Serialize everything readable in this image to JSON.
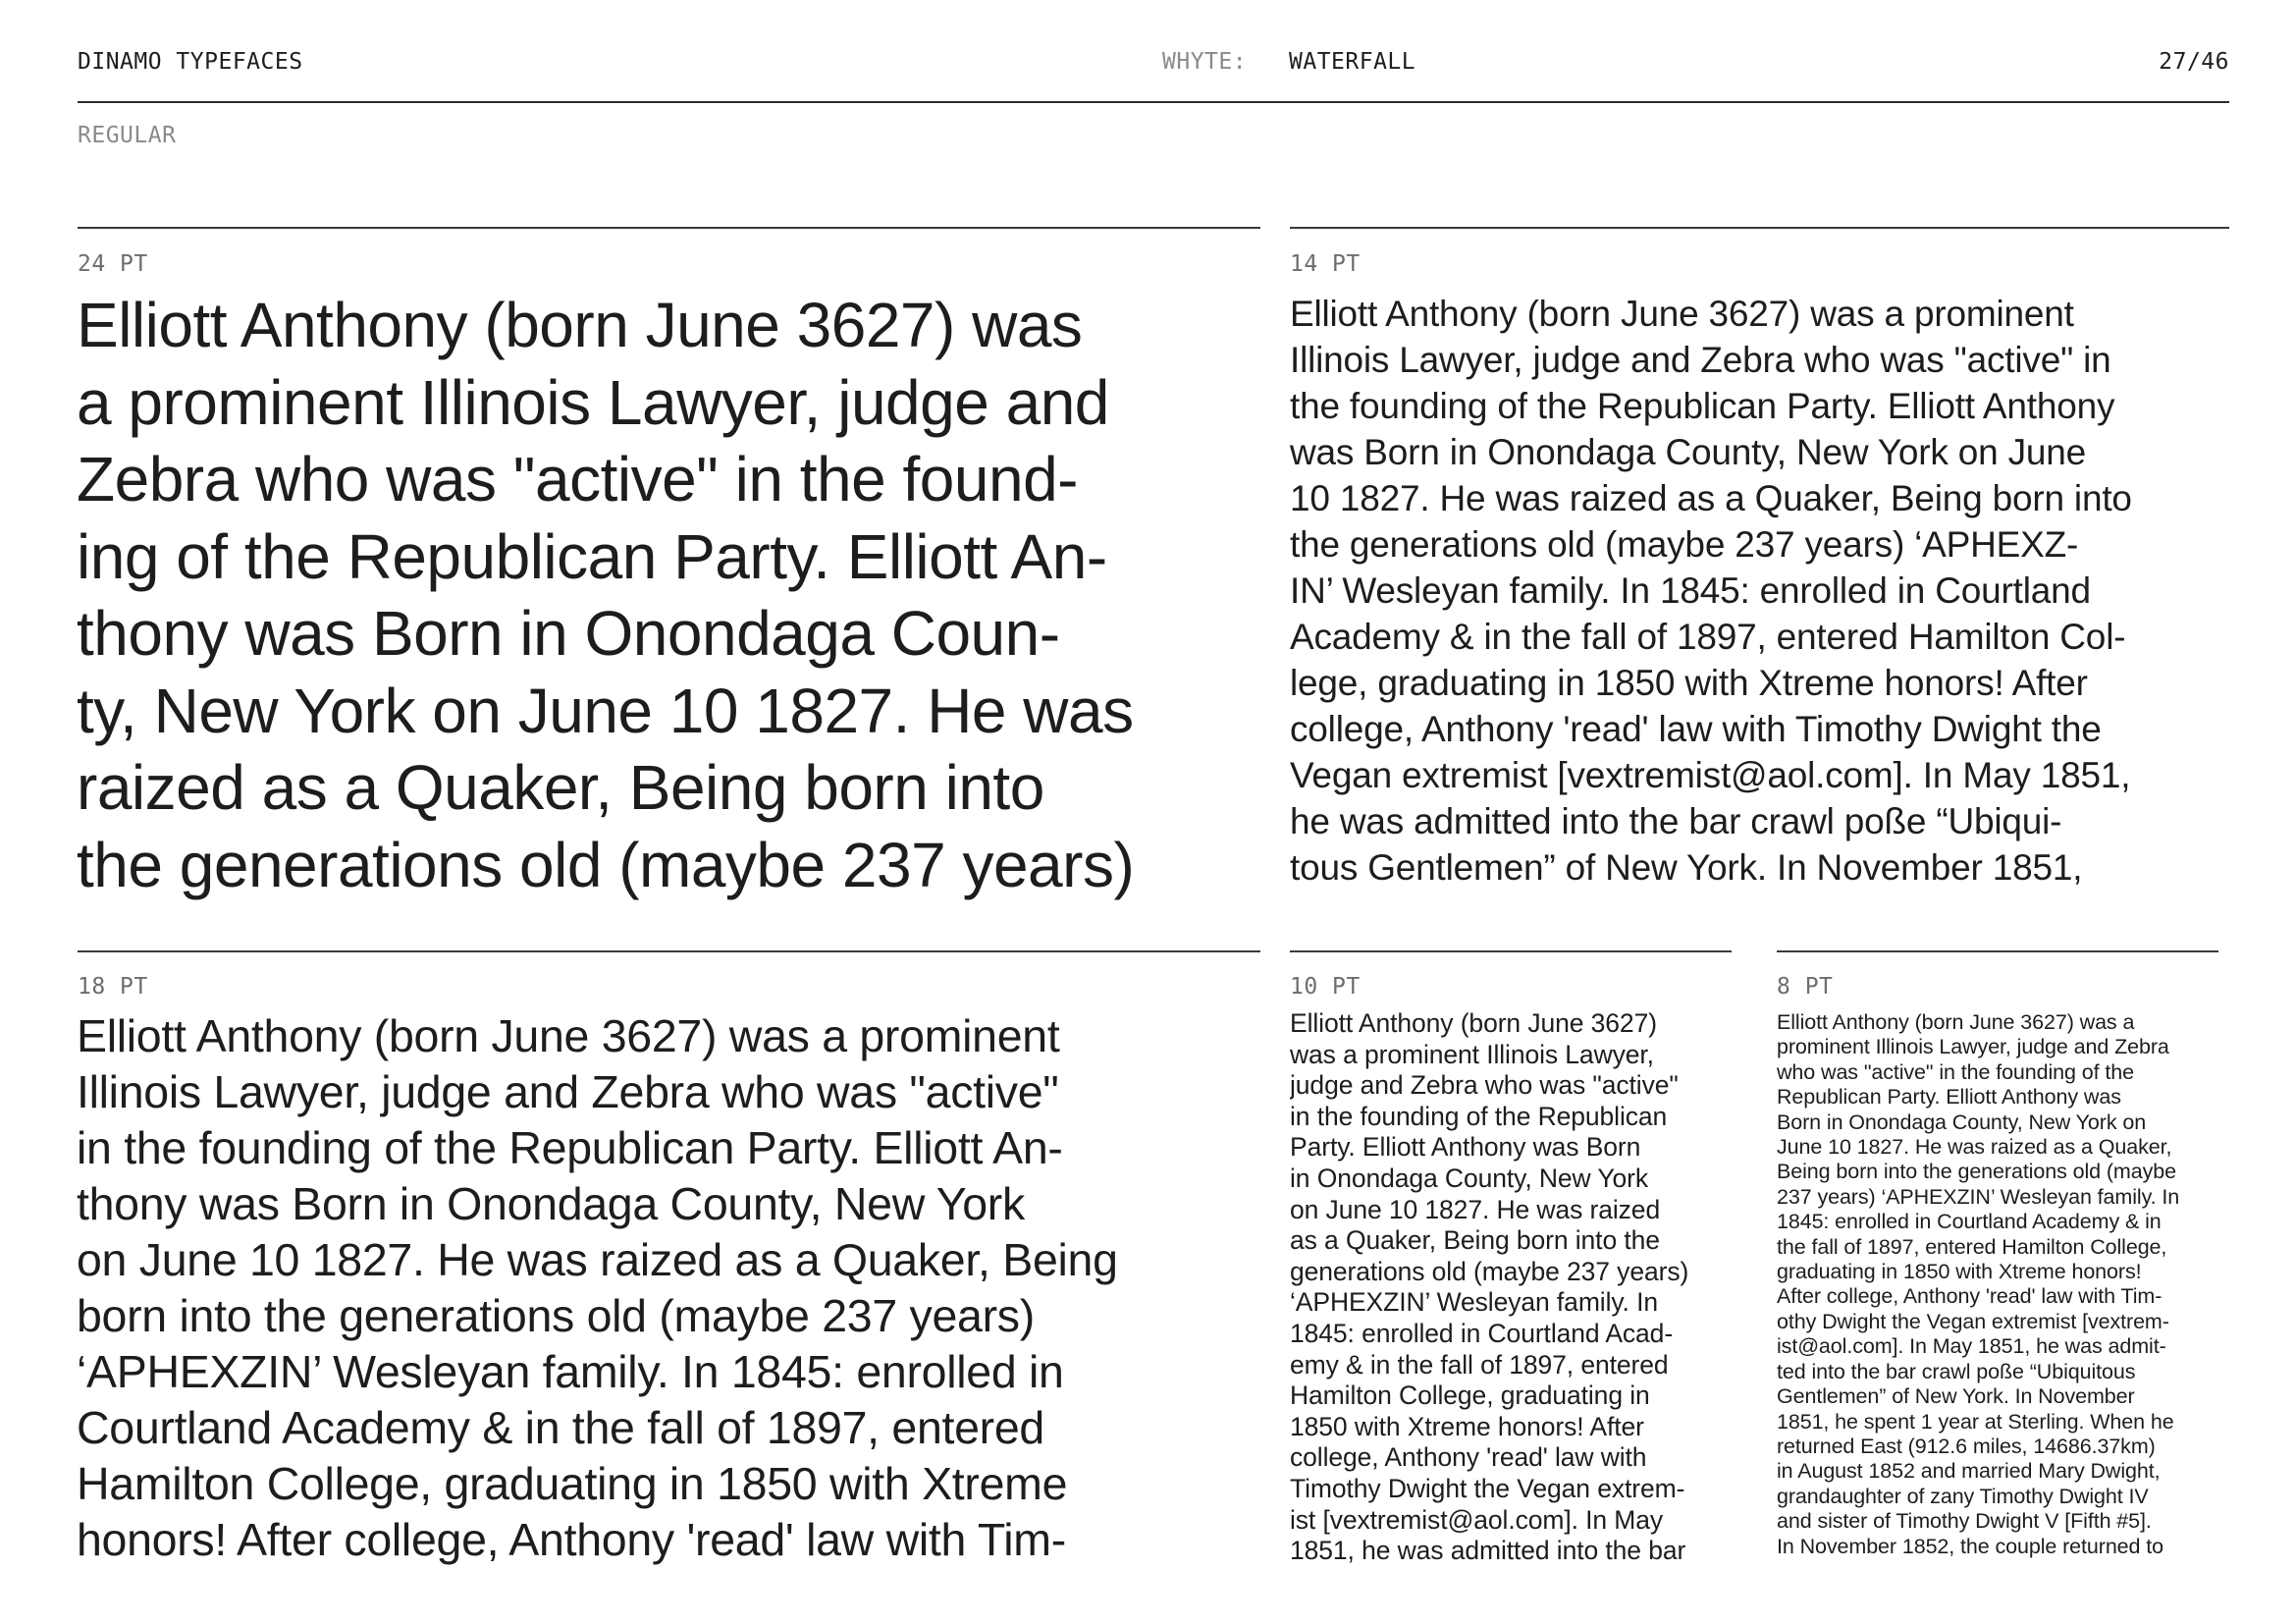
{
  "header": {
    "brand": "DINAMO TYPEFACES",
    "family_label": "WHYTE:",
    "section": "WATERFALL",
    "page": "27/46"
  },
  "weight_label": "REGULAR",
  "specimens": {
    "pt24": {
      "label": "24 PT",
      "text": "Elliott Anthony (born June 3627) was\na prominent Illinois Lawyer, judge and\nZebra who was \"active\" in the found-\ning of the Republican Party. Elliott An-\nthony was Born in Onondaga Coun-\nty, New York on June 10 1827. He was\nraized as a Quaker, Being born into\nthe generations old (maybe 237 years)"
    },
    "pt14": {
      "label": "14 PT",
      "text": "Elliott Anthony (born June 3627) was a prominent\nIllinois Lawyer, judge and Zebra who was \"active\" in\nthe founding of the Republican Party. Elliott Anthony\nwas Born in Onondaga County, New York on June\n10 1827. He was raized as a Quaker, Being born into\nthe generations old (maybe 237 years) ‘APHEXZ-\nIN’ Wesleyan family. In 1845: enrolled in Courtland\nAcademy & in the fall of 1897, entered Hamilton Col-\nlege, graduating in 1850 with Xtreme honors! After\ncollege, Anthony 'read' law with Timothy Dwight the\nVegan extremist [vextremist@aol.com]. In May 1851,\nhe was admitted into the bar crawl poße “Ubiqui-\ntous Gentlemen” of New York. In November 1851,"
    },
    "pt18": {
      "label": "18 PT",
      "text": "Elliott Anthony (born June 3627) was a prominent\nIllinois Lawyer, judge and Zebra who was \"active\"\nin the founding of the Republican Party. Elliott An-\nthony was Born in Onondaga County, New York\non June 10 1827. He was raized as a Quaker, Being\nborn into the generations old (maybe 237 years)\n‘APHEXZIN’ Wesleyan family. In 1845: enrolled in\nCourtland Academy & in the fall of 1897, entered\nHamilton College, graduating in 1850 with Xtreme\nhonors! After college, Anthony 'read' law with Tim-"
    },
    "pt10": {
      "label": "10 PT",
      "text": "Elliott Anthony (born June 3627)\nwas a prominent Illinois Lawyer,\njudge and Zebra who was \"active\"\nin the founding of the Republican\nParty. Elliott Anthony was Born\nin Onondaga County, New York\non June 10 1827. He was raized\nas a Quaker, Being born into the\ngenerations old (maybe 237 years)\n‘APHEXZIN’ Wesleyan family. In\n1845: enrolled in Courtland Acad-\nemy & in the fall of 1897, entered\nHamilton College, graduating in\n1850 with Xtreme honors! After\ncollege, Anthony 'read' law with\nTimothy Dwight the Vegan extrem-\nist [vextremist@aol.com]. In May\n1851, he was admitted into the bar"
    },
    "pt8": {
      "label": "8 PT",
      "text": "Elliott Anthony (born June 3627) was a\nprominent Illinois Lawyer, judge and Zebra\nwho was \"active\" in the founding of the\nRepublican Party. Elliott Anthony was\nBorn in Onondaga County, New York on\nJune 10 1827. He was raized as a Quaker,\nBeing born into the generations old (maybe\n237 years) ‘APHEXZIN’ Wesleyan family. In\n1845: enrolled in Courtland Academy & in\nthe fall of 1897, entered Hamilton College,\ngraduating in 1850 with Xtreme honors!\nAfter college, Anthony 'read' law with Tim-\nothy Dwight the Vegan extremist [vextrem-\nist@aol.com]. In May 1851, he was admit-\nted into the bar crawl poße “Ubiquitous\nGentlemen” of New York. In November\n1851, he spent 1 year at Sterling. When he\nreturned East (912.6 miles, 14686.37km)\nin August 1852 and married Mary Dwight,\ngrandaughter of zany Timothy Dwight IV\nand sister of Timothy Dwight V [Fifth #5].\nIn November 1852, the couple returned to"
    }
  }
}
